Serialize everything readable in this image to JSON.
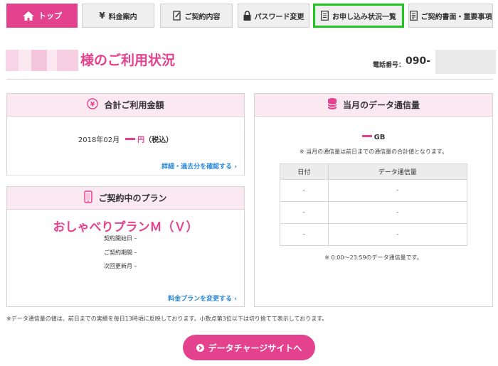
{
  "nav": {
    "tabs": [
      {
        "label": "トップ",
        "icon": "home-icon",
        "active": true
      },
      {
        "label": "料金案内",
        "icon": "yen-icon",
        "active": false
      },
      {
        "label": "ご契約内容",
        "icon": "edit-document-icon",
        "active": false
      },
      {
        "label": "パスワード変更",
        "icon": "lock-icon",
        "active": false
      },
      {
        "label": "お申し込み状況一覧",
        "icon": "list-document-icon",
        "active": false,
        "highlighted": true
      },
      {
        "label": "ご契約書面・重要事項",
        "icon": "document-icon",
        "active": false
      }
    ]
  },
  "header": {
    "greeting": "様のご利用状況",
    "phone_label": "電話番号：",
    "phone_number": "090-"
  },
  "billing": {
    "title": "合計ご利用金額",
    "month": "2018年02月",
    "unit": "円",
    "tax_note": "（税込）",
    "link": "詳細・過去分を確認する ›"
  },
  "plan": {
    "title": "ご契約中のプラン",
    "name": "おしゃべりプランＭ（Ｖ）",
    "start_label": "契約開始日 –",
    "period_label": "ご契約期間 –",
    "renewal_label": "次回更新月 –",
    "link": "料金プランを変更する ›"
  },
  "data_usage": {
    "title": "当月のデータ通信量",
    "unit": "GB",
    "note_top": "※ 当月の通信量は前日までの通信量の合計値となります。",
    "columns": [
      "日付",
      "データ通信量"
    ],
    "rows": [
      [
        "-",
        "-"
      ],
      [
        "-",
        "-"
      ],
      [
        "-",
        "-"
      ]
    ],
    "note_bottom": "※ 0:00〜23:59のデータ通信量です。"
  },
  "footnote": "※データ通信量の値は、前日までの実績を毎日13時頃に反映しております。小数点第3位以下は切り捨てて表示しております。",
  "cta": {
    "label": "データチャージサイトへ"
  },
  "colors": {
    "accent": "#e4428f",
    "highlight": "#1fc51f",
    "link": "#2a87d6",
    "panel_head": "#fbe9f2"
  }
}
